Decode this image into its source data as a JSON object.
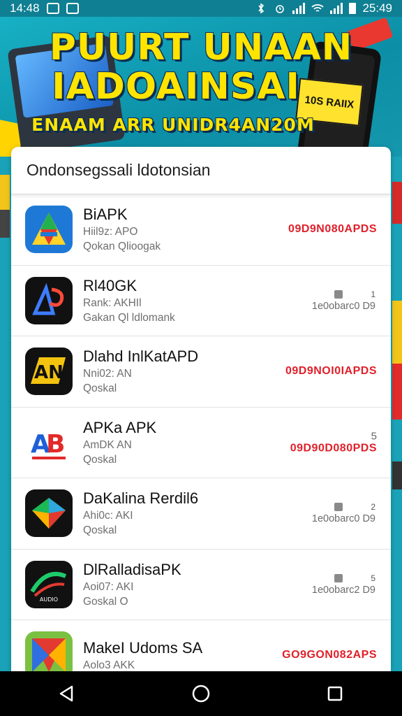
{
  "status_bar": {
    "time_left": "14:48",
    "time_right": "25:49"
  },
  "banner": {
    "line1": "PUURT UNAAN",
    "line2": "IADOAINSAI",
    "line3": "ENAAM ARR UNIDR4AN20M",
    "sticker": "10S RAIIX"
  },
  "list_header": "Ondonsegssali ldotonsian",
  "apps": [
    {
      "name": "BiAPK",
      "line1": "Hiil9z: APO",
      "line2": "Qokan Qlioogak",
      "right_type": "red",
      "right": "09D9N080APDS",
      "icon": "a-triangle-icon"
    },
    {
      "name": "Rl40GK",
      "line1": "Rank: AKHIl",
      "line2": "Gakan Ql ldlomank",
      "right_type": "grey",
      "right_top": "1",
      "right": "1e0obarc0 D9",
      "icon": "ab-red-icon"
    },
    {
      "name": "Dlahd InlKatAPD",
      "line1": "Nni02: AN",
      "line2": "Qoskal",
      "right_type": "red",
      "right": "09D9NOI0IAPDS",
      "icon": "an-yellow-icon"
    },
    {
      "name": "APKa APK",
      "line1": "AmDK AN",
      "line2": "Qoskal",
      "right_type": "stack",
      "right_top": "5",
      "right": "09D90D080PDS",
      "icon": "ab-blue-red-icon"
    },
    {
      "name": "DaKalina Rerdil6",
      "line1": "Ahi0c: AKI",
      "line2": "Qoskal",
      "right_type": "grey",
      "right_top": "2",
      "right": "1e0obarc0 D9",
      "icon": "diamond-green-icon"
    },
    {
      "name": "DlRalladisaPK",
      "line1": "Aoi07: AKI",
      "line2": "Goskal O",
      "right_type": "grey",
      "right_top": "5",
      "right": "1e0obarc2 D9",
      "icon": "swirl-green-icon"
    },
    {
      "name": "MakeI Udoms SA",
      "line1": "Aolo3 AKK",
      "line2": "",
      "right_type": "red",
      "right": "GO9GON082APS",
      "icon": "colorful-triangle-icon"
    }
  ]
}
